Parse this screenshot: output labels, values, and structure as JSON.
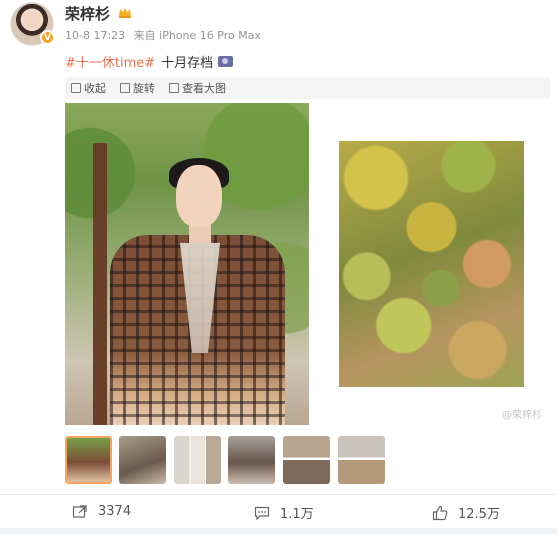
{
  "post": {
    "username": "荣梓杉",
    "time": "10-8 17:23",
    "source": "来自 iPhone 16 Pro Max",
    "hashtag": "#十一休time#",
    "text": "十月存档",
    "verified_badge": "V"
  },
  "toolbar": {
    "collect_label": "收起",
    "rotate_label": "旋转",
    "view_large_label": "查看大图"
  },
  "media": {
    "watermark": "@荣梓杉",
    "thumbnail_count": 6,
    "active_thumbnail": 1
  },
  "actions": {
    "repost_count": "3374",
    "comment_count": "1.1万",
    "like_count": "12.5万"
  },
  "colors": {
    "accent": "#eb7350",
    "badge": "#f6a623",
    "active_thumb_border": "#f4a55f"
  },
  "icons": [
    "avatar",
    "crown-icon",
    "camera-emoji-icon",
    "collapse-icon",
    "rotate-icon",
    "zoom-icon",
    "repost-icon",
    "comment-icon",
    "like-icon"
  ]
}
